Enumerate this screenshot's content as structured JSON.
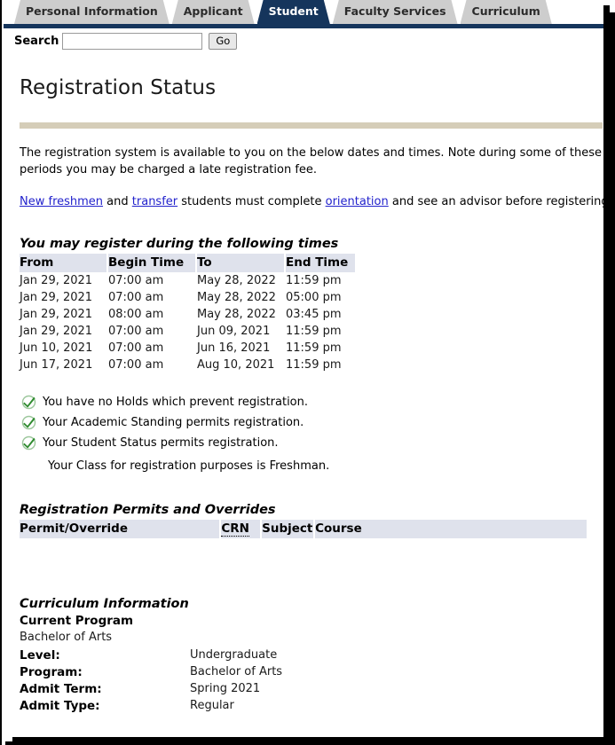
{
  "window": {
    "title": "Registration Status"
  },
  "tabs": [
    {
      "label": "Personal Information",
      "active": false
    },
    {
      "label": "Applicant",
      "active": false
    },
    {
      "label": "Student",
      "active": true
    },
    {
      "label": "Faculty Services",
      "active": false
    },
    {
      "label": "Curriculum",
      "active": false
    }
  ],
  "search": {
    "label": "Search",
    "value": "",
    "placeholder": "",
    "go_label": "Go"
  },
  "page": {
    "title": "Registration Status",
    "intro": "The registration system is available to you on the below dates and times. Note during some of these periods you may be charged a late registration fee.",
    "notice": {
      "link1": "New freshmen",
      "mid1": " and ",
      "link2": "transfer",
      "mid2": " students must complete ",
      "link3": "orientation",
      "tail": " and see an advisor before registering for classes."
    }
  },
  "register_times": {
    "heading": "You may register during the following times",
    "columns": [
      "From",
      "Begin Time",
      "To",
      "End Time"
    ],
    "rows": [
      {
        "from": "Jan 29, 2021",
        "begin": "07:00 am",
        "to": "May 28, 2022",
        "end": "11:59 pm"
      },
      {
        "from": "Jan 29, 2021",
        "begin": "07:00 am",
        "to": "May 28, 2022",
        "end": "05:00 pm"
      },
      {
        "from": "Jan 29, 2021",
        "begin": "08:00 am",
        "to": "May 28, 2022",
        "end": "03:45 pm"
      },
      {
        "from": "Jan 29, 2021",
        "begin": "07:00 am",
        "to": "Jun 09, 2021",
        "end": "11:59 pm"
      },
      {
        "from": "Jun 10, 2021",
        "begin": "07:00 am",
        "to": "Jun 16, 2021",
        "end": "11:59 pm"
      },
      {
        "from": "Jun 17, 2021",
        "begin": "07:00 am",
        "to": "Aug 10, 2021",
        "end": "11:59 pm"
      }
    ]
  },
  "status_checks": {
    "icon": "green-check-icon",
    "items": [
      {
        "text": "You have no Holds which prevent registration.",
        "has_check": true
      },
      {
        "text": "Your Academic Standing permits registration.",
        "has_check": true
      },
      {
        "text": "Your Student Status permits registration.",
        "has_check": true
      },
      {
        "text": "Your Class for registration purposes is Freshman.",
        "has_check": false
      }
    ]
  },
  "permits": {
    "heading": "Registration Permits and Overrides",
    "columns": [
      "Permit/Override",
      "CRN",
      "Subject",
      "Course"
    ],
    "rows": []
  },
  "curriculum": {
    "heading": "Curriculum Information",
    "subheading": "Current Program",
    "program_name": "Bachelor of Arts",
    "fields": [
      {
        "label": "Level:",
        "value": "Undergraduate"
      },
      {
        "label": "Program:",
        "value": "Bachelor of Arts"
      },
      {
        "label": "Admit Term:",
        "value": "Spring 2021"
      },
      {
        "label": "Admit Type:",
        "value": "Regular"
      }
    ]
  },
  "colors": {
    "tab_active_bg": "#15355c",
    "tab_inactive_bg": "#cdcdcd",
    "nav_underline": "#15355c",
    "rule_tan": "#d5cdb8",
    "table_header_bg": "#dfe2ec",
    "link": "#2222cc",
    "check_green": "#2f8b2f",
    "page_border": "#000000"
  }
}
